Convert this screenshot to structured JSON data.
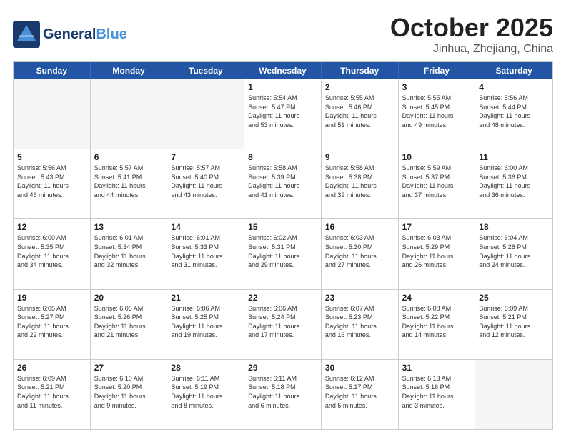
{
  "header": {
    "logo_line1": "General",
    "logo_line2": "Blue",
    "month": "October 2025",
    "location": "Jinhua, Zhejiang, China"
  },
  "days_of_week": [
    "Sunday",
    "Monday",
    "Tuesday",
    "Wednesday",
    "Thursday",
    "Friday",
    "Saturday"
  ],
  "weeks": [
    [
      {
        "day": "",
        "info": ""
      },
      {
        "day": "",
        "info": ""
      },
      {
        "day": "",
        "info": ""
      },
      {
        "day": "1",
        "info": "Sunrise: 5:54 AM\nSunset: 5:47 PM\nDaylight: 11 hours\nand 53 minutes."
      },
      {
        "day": "2",
        "info": "Sunrise: 5:55 AM\nSunset: 5:46 PM\nDaylight: 11 hours\nand 51 minutes."
      },
      {
        "day": "3",
        "info": "Sunrise: 5:55 AM\nSunset: 5:45 PM\nDaylight: 11 hours\nand 49 minutes."
      },
      {
        "day": "4",
        "info": "Sunrise: 5:56 AM\nSunset: 5:44 PM\nDaylight: 11 hours\nand 48 minutes."
      }
    ],
    [
      {
        "day": "5",
        "info": "Sunrise: 5:56 AM\nSunset: 5:43 PM\nDaylight: 11 hours\nand 46 minutes."
      },
      {
        "day": "6",
        "info": "Sunrise: 5:57 AM\nSunset: 5:41 PM\nDaylight: 11 hours\nand 44 minutes."
      },
      {
        "day": "7",
        "info": "Sunrise: 5:57 AM\nSunset: 5:40 PM\nDaylight: 11 hours\nand 43 minutes."
      },
      {
        "day": "8",
        "info": "Sunrise: 5:58 AM\nSunset: 5:39 PM\nDaylight: 11 hours\nand 41 minutes."
      },
      {
        "day": "9",
        "info": "Sunrise: 5:58 AM\nSunset: 5:38 PM\nDaylight: 11 hours\nand 39 minutes."
      },
      {
        "day": "10",
        "info": "Sunrise: 5:59 AM\nSunset: 5:37 PM\nDaylight: 11 hours\nand 37 minutes."
      },
      {
        "day": "11",
        "info": "Sunrise: 6:00 AM\nSunset: 5:36 PM\nDaylight: 11 hours\nand 36 minutes."
      }
    ],
    [
      {
        "day": "12",
        "info": "Sunrise: 6:00 AM\nSunset: 5:35 PM\nDaylight: 11 hours\nand 34 minutes."
      },
      {
        "day": "13",
        "info": "Sunrise: 6:01 AM\nSunset: 5:34 PM\nDaylight: 11 hours\nand 32 minutes."
      },
      {
        "day": "14",
        "info": "Sunrise: 6:01 AM\nSunset: 5:33 PM\nDaylight: 11 hours\nand 31 minutes."
      },
      {
        "day": "15",
        "info": "Sunrise: 6:02 AM\nSunset: 5:31 PM\nDaylight: 11 hours\nand 29 minutes."
      },
      {
        "day": "16",
        "info": "Sunrise: 6:03 AM\nSunset: 5:30 PM\nDaylight: 11 hours\nand 27 minutes."
      },
      {
        "day": "17",
        "info": "Sunrise: 6:03 AM\nSunset: 5:29 PM\nDaylight: 11 hours\nand 26 minutes."
      },
      {
        "day": "18",
        "info": "Sunrise: 6:04 AM\nSunset: 5:28 PM\nDaylight: 11 hours\nand 24 minutes."
      }
    ],
    [
      {
        "day": "19",
        "info": "Sunrise: 6:05 AM\nSunset: 5:27 PM\nDaylight: 11 hours\nand 22 minutes."
      },
      {
        "day": "20",
        "info": "Sunrise: 6:05 AM\nSunset: 5:26 PM\nDaylight: 11 hours\nand 21 minutes."
      },
      {
        "day": "21",
        "info": "Sunrise: 6:06 AM\nSunset: 5:25 PM\nDaylight: 11 hours\nand 19 minutes."
      },
      {
        "day": "22",
        "info": "Sunrise: 6:06 AM\nSunset: 5:24 PM\nDaylight: 11 hours\nand 17 minutes."
      },
      {
        "day": "23",
        "info": "Sunrise: 6:07 AM\nSunset: 5:23 PM\nDaylight: 11 hours\nand 16 minutes."
      },
      {
        "day": "24",
        "info": "Sunrise: 6:08 AM\nSunset: 5:22 PM\nDaylight: 11 hours\nand 14 minutes."
      },
      {
        "day": "25",
        "info": "Sunrise: 6:09 AM\nSunset: 5:21 PM\nDaylight: 11 hours\nand 12 minutes."
      }
    ],
    [
      {
        "day": "26",
        "info": "Sunrise: 6:09 AM\nSunset: 5:21 PM\nDaylight: 11 hours\nand 11 minutes."
      },
      {
        "day": "27",
        "info": "Sunrise: 6:10 AM\nSunset: 5:20 PM\nDaylight: 11 hours\nand 9 minutes."
      },
      {
        "day": "28",
        "info": "Sunrise: 6:11 AM\nSunset: 5:19 PM\nDaylight: 11 hours\nand 8 minutes."
      },
      {
        "day": "29",
        "info": "Sunrise: 6:11 AM\nSunset: 5:18 PM\nDaylight: 11 hours\nand 6 minutes."
      },
      {
        "day": "30",
        "info": "Sunrise: 6:12 AM\nSunset: 5:17 PM\nDaylight: 11 hours\nand 5 minutes."
      },
      {
        "day": "31",
        "info": "Sunrise: 6:13 AM\nSunset: 5:16 PM\nDaylight: 11 hours\nand 3 minutes."
      },
      {
        "day": "",
        "info": ""
      }
    ]
  ]
}
